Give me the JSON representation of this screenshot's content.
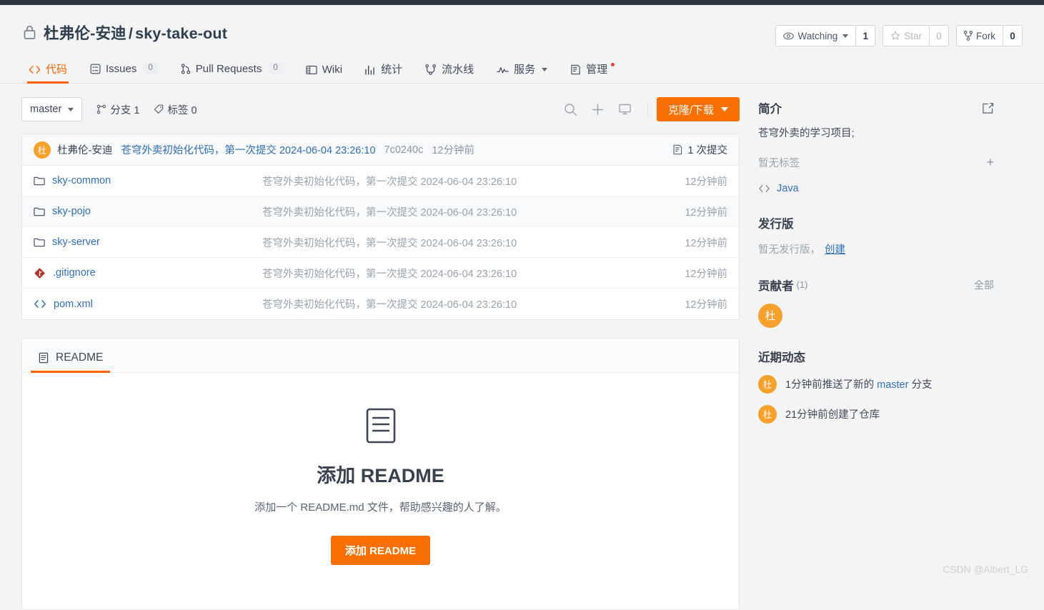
{
  "header": {
    "lock_icon": "lock-icon",
    "owner": "杜弗伦-安迪",
    "separator": "/",
    "repo_name": "sky-take-out",
    "actions": {
      "watching_label": "Watching",
      "watching_count": "1",
      "star_label": "Star",
      "star_count": "0",
      "fork_label": "Fork",
      "fork_count": "0"
    }
  },
  "tabs": [
    {
      "label": "代码",
      "icon": "code-icon",
      "badge": null,
      "active": true
    },
    {
      "label": "Issues",
      "icon": "issue-icon",
      "badge": "0",
      "active": false
    },
    {
      "label": "Pull Requests",
      "icon": "pull-request-icon",
      "badge": "0",
      "active": false
    },
    {
      "label": "Wiki",
      "icon": "book-icon",
      "badge": null,
      "active": false
    },
    {
      "label": "统计",
      "icon": "chart-icon",
      "badge": null,
      "active": false
    },
    {
      "label": "流水线",
      "icon": "pipeline-icon",
      "badge": null,
      "active": false
    },
    {
      "label": "服务",
      "icon": "pulse-icon",
      "badge": null,
      "active": false,
      "caret": true
    },
    {
      "label": "管理",
      "icon": "manage-icon",
      "badge": null,
      "active": false,
      "dot": true
    }
  ],
  "branch_bar": {
    "branch_name": "master",
    "branches_label": "分支 1",
    "tags_label": "标签 0",
    "search_icon": "search-icon",
    "add_icon": "plus-icon",
    "desktop_icon": "monitor-icon",
    "clone_label": "克隆/下载"
  },
  "latest_commit": {
    "avatar_initial": "杜",
    "author": "杜弗伦-安迪",
    "message": "苍穹外卖初始化代码，第一次提交 2024-06-04 23:26:10",
    "sha": "7c0240c",
    "time": "12分钟前",
    "commits_count_label": "1 次提交",
    "commits_icon": "commit-history-icon"
  },
  "files": [
    {
      "name": "sky-common",
      "icon": "folder-icon",
      "message": "苍穹外卖初始化代码，第一次提交 2024-06-04 23:26:10",
      "time": "12分钟前"
    },
    {
      "name": "sky-pojo",
      "icon": "folder-icon",
      "message": "苍穹外卖初始化代码，第一次提交 2024-06-04 23:26:10",
      "time": "12分钟前"
    },
    {
      "name": "sky-server",
      "icon": "folder-icon",
      "message": "苍穹外卖初始化代码，第一次提交 2024-06-04 23:26:10",
      "time": "12分钟前"
    },
    {
      "name": ".gitignore",
      "icon": "git-file-icon",
      "message": "苍穹外卖初始化代码，第一次提交 2024-06-04 23:26:10",
      "time": "12分钟前"
    },
    {
      "name": "pom.xml",
      "icon": "code-file-icon",
      "message": "苍穹外卖初始化代码，第一次提交 2024-06-04 23:26:10",
      "time": "12分钟前"
    }
  ],
  "readme": {
    "tab_label": "README",
    "tab_icon": "document-icon",
    "empty_icon": "document-large-icon",
    "title": "添加 README",
    "description": "添加一个 README.md 文件，帮助感兴趣的人了解。",
    "button_label": "添加 README"
  },
  "sidebar": {
    "about": {
      "title": "简介",
      "edit_icon": "edit-icon",
      "description": "苍穹外卖的学习项目;",
      "tags_empty": "暂无标签",
      "add_tag_icon": "plus-icon",
      "language": "Java",
      "language_icon": "code-icon"
    },
    "releases": {
      "title": "发行版",
      "empty_text": "暂无发行版，",
      "create_link": "创建"
    },
    "contributors": {
      "title": "贡献者",
      "count": "(1)",
      "all_link": "全部",
      "avatars": [
        {
          "initial": "杜"
        }
      ]
    },
    "activity": {
      "title": "近期动态",
      "items": [
        {
          "avatar_initial": "杜",
          "prefix": "1分钟前推送了新的",
          "link": "master",
          "suffix": "分支"
        },
        {
          "avatar_initial": "杜",
          "prefix": "21分钟前创建了仓库",
          "link": "",
          "suffix": ""
        }
      ]
    }
  },
  "watermark": "CSDN @Albert_LG",
  "colors": {
    "accent_orange": "#fa7000",
    "link_blue": "#3070b5",
    "topbar_dark": "#2f3442",
    "avatar_orange": "#f7a12c"
  }
}
